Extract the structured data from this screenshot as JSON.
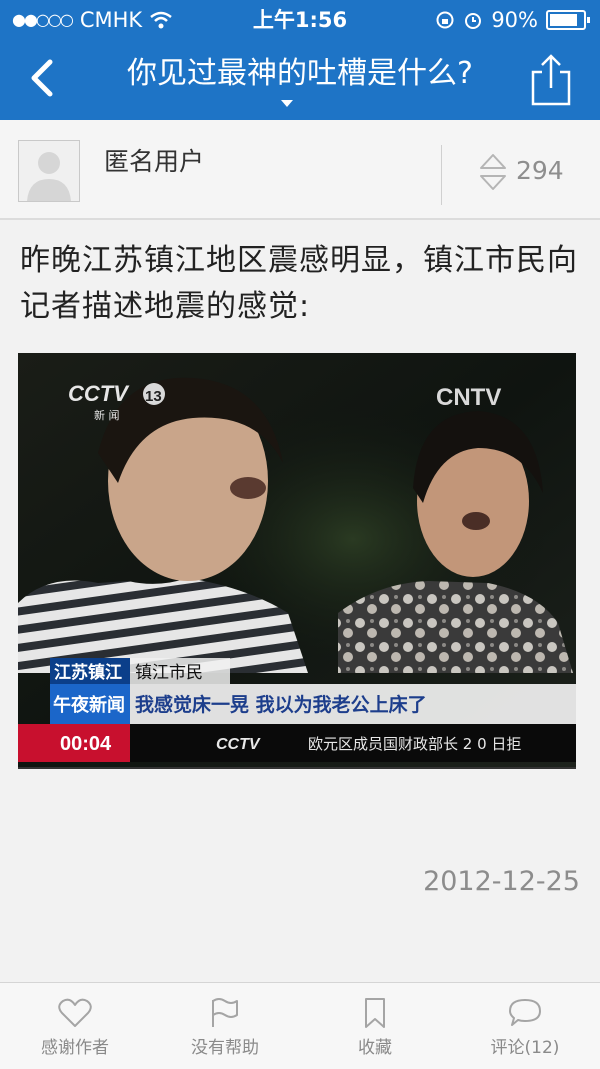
{
  "status_bar": {
    "signal_dots": "●●○○○",
    "carrier": "CMHK",
    "time": "上午1:56",
    "battery": "90%"
  },
  "nav": {
    "title": "你见过最神的吐槽是什么?"
  },
  "answer": {
    "author": "匿名用户",
    "votes": "294",
    "text": "昨晚江苏镇江地区震感明显，镇江市民向记者描述地震的感觉:",
    "date": "2012-12-25"
  },
  "video": {
    "logo_left": "CCTV",
    "logo_left_channel": "13",
    "logo_left_sub": "新 闻",
    "logo_right": "CNTV",
    "place_tag": "江苏镇江",
    "speaker_tag": "镇江市民",
    "program_tag": "午夜新闻",
    "subtitle": "我感觉床一晃 我以为我老公上床了",
    "timer": "00:04",
    "ticker_logo": "CCTV",
    "ticker": "欧元区成员国财政部长 2 0 日拒"
  },
  "tabs": [
    {
      "label": "感谢作者",
      "icon": "heart-icon"
    },
    {
      "label": "没有帮助",
      "icon": "flag-icon"
    },
    {
      "label": "收藏",
      "icon": "bookmark-icon"
    },
    {
      "label": "评论(12)",
      "icon": "comment-icon"
    }
  ]
}
